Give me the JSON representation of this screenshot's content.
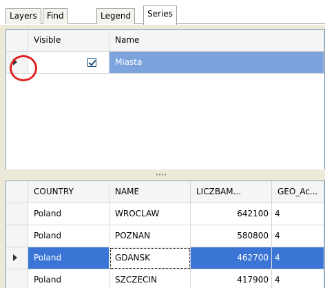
{
  "tabs": [
    {
      "label": "Layers"
    },
    {
      "label": "Find"
    },
    {
      "label": "Legend"
    },
    {
      "label": "Series",
      "active": true
    }
  ],
  "series_grid": {
    "columns": [
      "Visible",
      "Name"
    ],
    "rows": [
      {
        "visible": true,
        "name": "Miasta",
        "selected": true
      }
    ]
  },
  "data_grid": {
    "columns": [
      "COUNTRY",
      "NAME",
      "LICZBAM...",
      "GEO_Ac..."
    ],
    "rows": [
      {
        "country": "Poland",
        "name": "WROCLAW",
        "liczbam": "642100",
        "geo": "4"
      },
      {
        "country": "Poland",
        "name": "POZNAN",
        "liczbam": "580800",
        "geo": "4"
      },
      {
        "country": "Poland",
        "name": "GDANSK",
        "liczbam": "462700",
        "geo": "4",
        "selected": true
      },
      {
        "country": "Poland",
        "name": "SZCZECIN",
        "liczbam": "417900",
        "geo": "4"
      }
    ]
  },
  "icons": {
    "row_pointer": "chevron-right-icon",
    "checkbox": "checkbox-checked-icon"
  },
  "colors": {
    "selection": "#3a75d6",
    "highlight_ring": "#e02020"
  }
}
